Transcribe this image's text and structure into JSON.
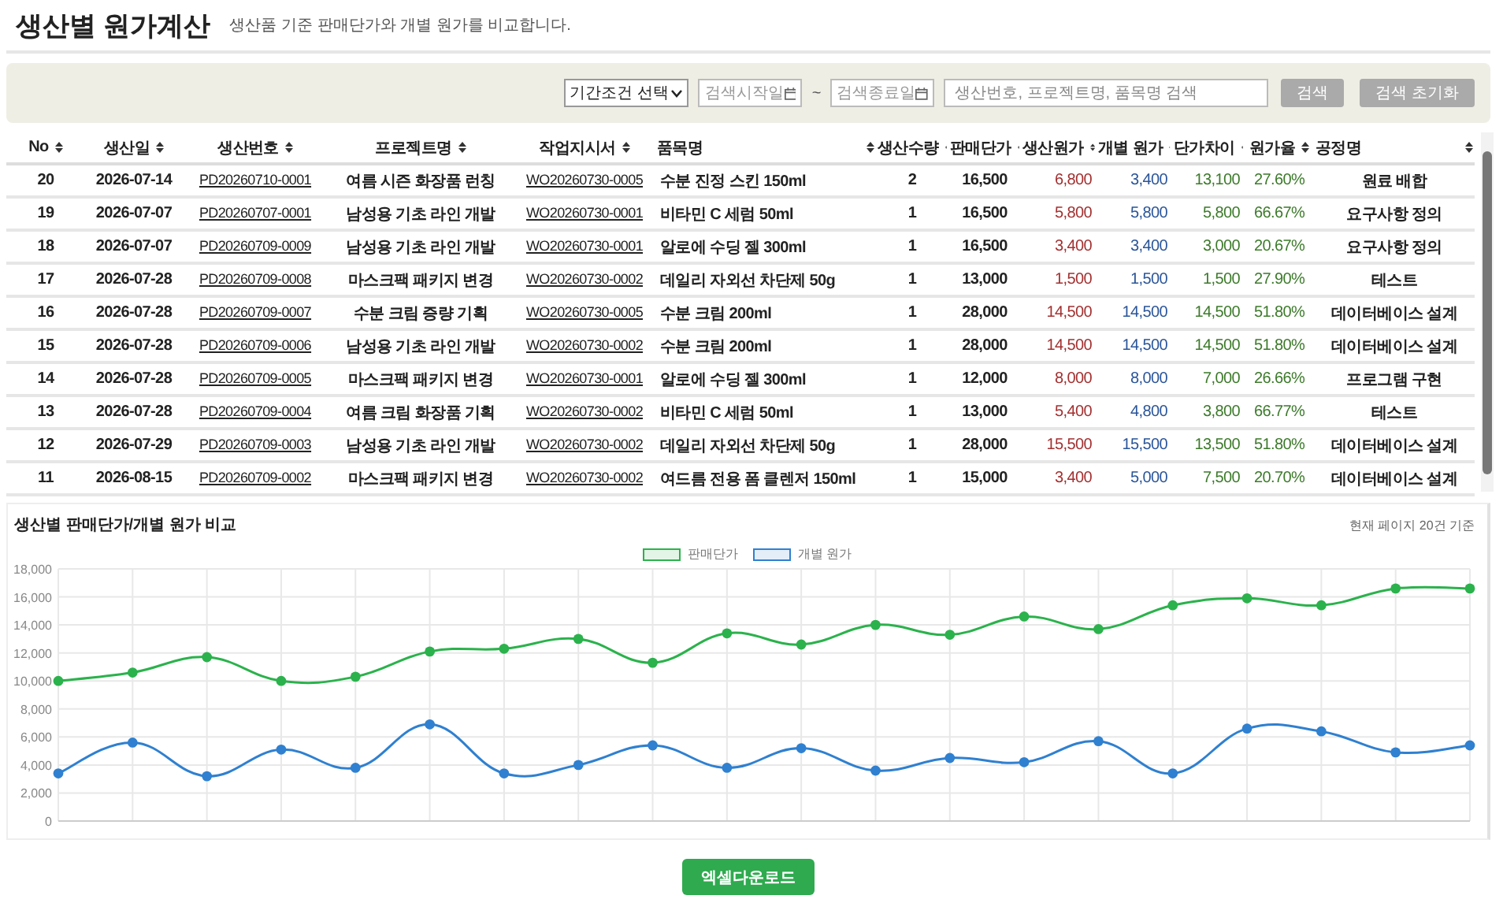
{
  "page": {
    "title": "생산별 원가계산",
    "subtitle": "생산품 기준 판매단가와 개별 원가를 비교합니다."
  },
  "filters": {
    "period_select": "기간조건 선택",
    "start_date": {
      "placeholder": "검색시작일"
    },
    "separator": "~",
    "end_date": {
      "placeholder": "검색종료일"
    },
    "search": {
      "placeholder": "생산번호, 프로젝트명, 품목명 검색"
    },
    "buttons": [
      "검색",
      "검색 초기화"
    ]
  },
  "table": {
    "columns": [
      "No",
      "생산일",
      "생산번호",
      "프로젝트명",
      "작업지시서",
      "품목명",
      "생산수량",
      "판매단가",
      "생산원가",
      "개별 원가",
      "단가차이",
      "원가율",
      "공정명"
    ],
    "rows": [
      [
        "20",
        "2026-07-14",
        "PD20260710-0001",
        "여름 시즌 화장품 런칭",
        "WO20260730-0005",
        "수분 진정 스킨 150ml",
        "2",
        "16,500",
        "6,800",
        "3,400",
        "13,100",
        "27.60%",
        "원료 배합"
      ],
      [
        "19",
        "2026-07-07",
        "PD20260707-0001",
        "남성용 기초 라인 개발",
        "WO20260730-0001",
        "비타민 C 세럼 50ml",
        "1",
        "16,500",
        "5,800",
        "5,800",
        "5,800",
        "66.67%",
        "요구사항 정의"
      ],
      [
        "18",
        "2026-07-07",
        "PD20260709-0009",
        "남성용 기초 라인 개발",
        "WO20260730-0001",
        "알로에 수딩 젤 300ml",
        "1",
        "16,500",
        "3,400",
        "3,400",
        "3,000",
        "20.67%",
        "요구사항 정의"
      ],
      [
        "17",
        "2026-07-28",
        "PD20260709-0008",
        "마스크팩 패키지 변경",
        "WO20260730-0002",
        "데일리 자외선 차단제 50g",
        "1",
        "13,000",
        "1,500",
        "1,500",
        "1,500",
        "27.90%",
        "테스트"
      ],
      [
        "16",
        "2026-07-28",
        "PD20260709-0007",
        "수분 크림 증량 기획",
        "WO20260730-0005",
        "수분 크림 200ml",
        "1",
        "28,000",
        "14,500",
        "14,500",
        "14,500",
        "51.80%",
        "데이터베이스 설계"
      ],
      [
        "15",
        "2026-07-28",
        "PD20260709-0006",
        "남성용 기초 라인 개발",
        "WO20260730-0002",
        "수분 크림 200ml",
        "1",
        "28,000",
        "14,500",
        "14,500",
        "14,500",
        "51.80%",
        "데이터베이스 설계"
      ],
      [
        "14",
        "2026-07-28",
        "PD20260709-0005",
        "마스크팩 패키지 변경",
        "WO20260730-0001",
        "알로에 수딩 젤 300ml",
        "1",
        "12,000",
        "8,000",
        "8,000",
        "7,000",
        "26.66%",
        "프로그램 구현"
      ],
      [
        "13",
        "2026-07-28",
        "PD20260709-0004",
        "여름 크림 화장품 기획",
        "WO20260730-0002",
        "비타민 C 세럼 50ml",
        "1",
        "13,000",
        "5,400",
        "4,800",
        "3,800",
        "66.77%",
        "테스트"
      ],
      [
        "12",
        "2026-07-29",
        "PD20260709-0003",
        "남성용 기초 라인 개발",
        "WO20260730-0002",
        "데일리 자외선 차단제 50g",
        "1",
        "28,000",
        "15,500",
        "15,500",
        "13,500",
        "51.80%",
        "데이터베이스 설계"
      ],
      [
        "11",
        "2026-08-15",
        "PD20260709-0002",
        "마스크팩 패키지 변경",
        "WO20260730-0002",
        "여드름 전용 폼 클렌저 150ml",
        "1",
        "15,000",
        "3,400",
        "5,000",
        "7,500",
        "20.70%",
        "데이터베이스 설계"
      ]
    ]
  },
  "chart_panel": {
    "title": "생산별 판매단가/개별 원가 비교",
    "note": "현재 페이지 20건 기준",
    "chart_data": {
      "type": "line",
      "grid": true,
      "ylim": [
        0,
        18000
      ],
      "yticks": [
        {
          "value": 0,
          "label": "0"
        },
        {
          "value": 2000,
          "label": "2,000"
        },
        {
          "value": 4000,
          "label": "4,000"
        },
        {
          "value": 6000,
          "label": "6,000"
        },
        {
          "value": 8000,
          "label": "8,000"
        },
        {
          "value": 10000,
          "label": "10,000"
        },
        {
          "value": 12000,
          "label": "12,000"
        },
        {
          "value": 14000,
          "label": "14,000"
        },
        {
          "value": 16000,
          "label": "16,000"
        },
        {
          "value": 18000,
          "label": "18,000"
        }
      ],
      "series": [
        {
          "name": "판매단가",
          "color": "#2bb24c",
          "marker": "circle",
          "values": [
            10000,
            10600,
            11700,
            10000,
            10300,
            12100,
            12300,
            13000,
            11300,
            13400,
            12600,
            14000,
            13300,
            14600,
            13700,
            15400,
            15900,
            15400,
            16600,
            16600
          ]
        },
        {
          "name": "개별 원가",
          "color": "#2f80d0",
          "marker": "circle",
          "values": [
            3400,
            5600,
            3200,
            5100,
            3800,
            6900,
            3400,
            4000,
            5400,
            3800,
            5200,
            3600,
            4500,
            4200,
            5700,
            3400,
            6600,
            6400,
            4900,
            5400
          ]
        }
      ]
    }
  },
  "download_button": "엑셀다운로드"
}
